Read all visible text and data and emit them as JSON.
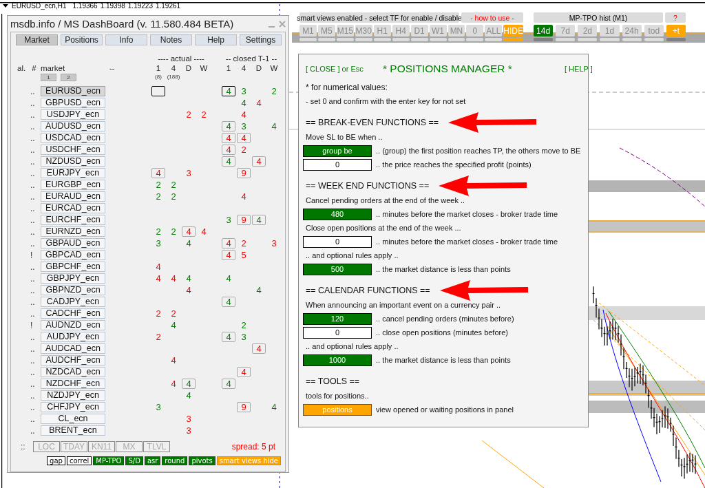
{
  "chart": {
    "symbol": "EURUSD_ecn,H1",
    "prices": [
      "1.19366",
      "1.19398",
      "1.19223",
      "1.19261"
    ]
  },
  "dashboard": {
    "title": "msdb.info / MS DashBoard (v. 11.580.484 BETA)",
    "tabs": [
      {
        "label": "Market",
        "selected": true
      },
      {
        "label": "Positions",
        "selected": false
      },
      {
        "label": "Info",
        "selected": false
      },
      {
        "label": "Notes",
        "selected": false
      },
      {
        "label": "Help",
        "selected": false
      },
      {
        "label": "Settings",
        "selected": false
      }
    ],
    "group_labels": [
      "---- actual ----",
      "-- closed T-1 --"
    ],
    "header": [
      "al.",
      "#",
      "market",
      "--"
    ],
    "actual_columns": [
      "1",
      "4",
      "D",
      "W"
    ],
    "closed_columns": [
      "1",
      "4",
      "D",
      "W"
    ],
    "pages": [
      "1",
      "2"
    ],
    "actual_counts": [
      "(8)",
      "(188)"
    ],
    "rows": [
      {
        "alert": "..",
        "symbol": "EURUSD_ecn",
        "selected": true,
        "cells": {
          "actual_1": {
            "framed": true,
            "highlighted": true
          },
          "closed_1": {
            "value": "4",
            "color": "#008000",
            "framed": true,
            "highlighted": true
          },
          "closed_4": {
            "value": "3",
            "color": "#008000"
          },
          "closed_w": {
            "value": "2",
            "color": "#008000"
          }
        }
      },
      {
        "alert": "..",
        "symbol": "GBPUSD_ecn",
        "selected": false,
        "cells": {
          "closed_4": {
            "value": "4",
            "color": "#008000"
          },
          "closed_d": {
            "value": "4",
            "color": "#ff0000"
          }
        }
      },
      {
        "alert": "..",
        "symbol": "USDJPY_ecn",
        "selected": false,
        "cells": {
          "actual_d": {
            "value": "2",
            "color": "#ff0000"
          },
          "actual_w": {
            "value": "2",
            "color": "#ff0000"
          },
          "closed_4": {
            "value": "4",
            "color": "#ff0000"
          }
        }
      },
      {
        "alert": "..",
        "symbol": "AUDUSD_ecn",
        "selected": false,
        "cells": {
          "closed_1": {
            "value": "4",
            "color": "#008000",
            "framed": true
          },
          "closed_4": {
            "value": "3",
            "color": "#008000"
          },
          "closed_w": {
            "value": "4",
            "color": "#008000"
          }
        }
      },
      {
        "alert": "..",
        "symbol": "USDCAD_ecn",
        "selected": false,
        "cells": {
          "closed_1": {
            "value": "4",
            "color": "#ff0000",
            "framed": true
          },
          "closed_4": {
            "value": "4",
            "color": "#ff0000",
            "framed": true
          }
        }
      },
      {
        "alert": "..",
        "symbol": "USDCHF_ecn",
        "selected": false,
        "cells": {
          "closed_1": {
            "value": "4",
            "color": "#ff0000",
            "framed": true
          },
          "closed_4": {
            "value": "2",
            "color": "#ff0000"
          }
        }
      },
      {
        "alert": "..",
        "symbol": "NZDUSD_ecn",
        "selected": false,
        "cells": {
          "closed_1": {
            "value": "4",
            "color": "#008000",
            "framed": true
          },
          "closed_d": {
            "value": "4",
            "color": "#ff0000",
            "framed": true
          }
        }
      },
      {
        "alert": "..",
        "symbol": "EURJPY_ecn",
        "selected": false,
        "cells": {
          "actual_1": {
            "value": "4",
            "color": "#ff0000",
            "framed": true
          },
          "actual_d": {
            "value": "3",
            "color": "#ff0000"
          },
          "closed_4": {
            "value": "9",
            "color": "#ff0000",
            "framed": true
          }
        }
      },
      {
        "alert": "..",
        "symbol": "EURGBP_ecn",
        "selected": false,
        "cells": {
          "actual_1": {
            "value": "2",
            "color": "#008000"
          },
          "actual_4": {
            "value": "2",
            "color": "#008000"
          }
        }
      },
      {
        "alert": "..",
        "symbol": "EURAUD_ecn",
        "selected": false,
        "cells": {
          "actual_1": {
            "value": "2",
            "color": "#008000"
          },
          "actual_4": {
            "value": "2",
            "color": "#008000"
          },
          "closed_4": {
            "value": "4",
            "color": "#ff0000"
          }
        }
      },
      {
        "alert": "..",
        "symbol": "EURCAD_ecn",
        "selected": false
      },
      {
        "alert": "..",
        "symbol": "EURCHF_ecn",
        "selected": false,
        "cells": {
          "closed_1": {
            "value": "3",
            "color": "#008000"
          },
          "closed_4": {
            "value": "9",
            "color": "#ff0000",
            "framed": true
          },
          "closed_d": {
            "value": "4",
            "color": "#008000",
            "framed": true
          }
        }
      },
      {
        "alert": "..",
        "symbol": "EURNZD_ecn",
        "selected": false,
        "cells": {
          "actual_1": {
            "value": "2",
            "color": "#008000"
          },
          "actual_4": {
            "value": "2",
            "color": "#008000"
          },
          "actual_d": {
            "value": "4",
            "color": "#ff0000",
            "framed": true
          },
          "actual_w": {
            "value": "4",
            "color": "#ff0000"
          }
        }
      },
      {
        "alert": "..",
        "symbol": "GBPAUD_ecn",
        "selected": false,
        "cells": {
          "actual_1": {
            "value": "3",
            "color": "#008000"
          },
          "actual_d": {
            "value": "4",
            "color": "#008000"
          },
          "closed_1": {
            "value": "4",
            "color": "#ff0000",
            "framed": true
          },
          "closed_4": {
            "value": "2",
            "color": "#ff0000"
          },
          "closed_w": {
            "value": "3",
            "color": "#ff0000"
          }
        }
      },
      {
        "alert": "!",
        "symbol": "GBPCAD_ecn",
        "selected": false,
        "cells": {
          "closed_1": {
            "value": "4",
            "color": "#ff0000",
            "framed": true
          },
          "closed_4": {
            "value": "5",
            "color": "#ff0000"
          }
        }
      },
      {
        "alert": "..",
        "symbol": "GBPCHF_ecn",
        "selected": false,
        "cells": {
          "actual_1": {
            "value": "4",
            "color": "#ff0000"
          }
        }
      },
      {
        "alert": "..",
        "symbol": "GBPJPY_ecn",
        "selected": false,
        "cells": {
          "actual_1": {
            "value": "4",
            "color": "#ff0000"
          },
          "actual_4": {
            "value": "4",
            "color": "#ff0000"
          },
          "actual_d": {
            "value": "4",
            "color": "#008000"
          },
          "closed_1": {
            "value": "4",
            "color": "#008000"
          }
        }
      },
      {
        "alert": "..",
        "symbol": "GBPNZD_ecn",
        "selected": false,
        "cells": {
          "actual_d": {
            "value": "4",
            "color": "#ff0000"
          },
          "closed_d": {
            "value": "4",
            "color": "#008000"
          }
        }
      },
      {
        "alert": "..",
        "symbol": "CADJPY_ecn",
        "selected": false,
        "cells": {
          "closed_1": {
            "value": "4",
            "color": "#008000",
            "framed": true
          }
        }
      },
      {
        "alert": "..",
        "symbol": "CADCHF_ecn",
        "selected": false,
        "cells": {
          "actual_1": {
            "value": "2",
            "color": "#ff0000"
          },
          "actual_4": {
            "value": "2",
            "color": "#ff0000"
          }
        }
      },
      {
        "alert": "!",
        "symbol": "AUDNZD_ecn",
        "selected": false,
        "cells": {
          "actual_4": {
            "value": "4",
            "color": "#008000"
          },
          "closed_4": {
            "value": "2",
            "color": "#008000"
          }
        }
      },
      {
        "alert": "..",
        "symbol": "AUDJPY_ecn",
        "selected": false,
        "cells": {
          "actual_1": {
            "value": "2",
            "color": "#ff0000"
          },
          "closed_1": {
            "value": "4",
            "color": "#008000",
            "framed": true
          },
          "closed_4": {
            "value": "3",
            "color": "#008000"
          }
        }
      },
      {
        "alert": "..",
        "symbol": "AUDCAD_ecn",
        "selected": false,
        "cells": {
          "closed_d": {
            "value": "4",
            "color": "#ff0000",
            "framed": true
          }
        }
      },
      {
        "alert": "..",
        "symbol": "AUDCHF_ecn",
        "selected": false,
        "cells": {
          "actual_4": {
            "value": "4",
            "color": "#ff0000"
          }
        }
      },
      {
        "alert": "..",
        "symbol": "NZDCAD_ecn",
        "selected": false,
        "cells": {
          "closed_4": {
            "value": "4",
            "color": "#ff0000",
            "framed": true
          }
        }
      },
      {
        "alert": "..",
        "symbol": "NZDCHF_ecn",
        "selected": false,
        "cells": {
          "actual_4": {
            "value": "4",
            "color": "#ff0000"
          },
          "actual_d": {
            "value": "4",
            "color": "#008000",
            "framed": true
          },
          "closed_1": {
            "value": "4",
            "color": "#008000",
            "framed": true
          }
        }
      },
      {
        "alert": "..",
        "symbol": "NZDJPY_ecn",
        "selected": false,
        "cells": {
          "actual_d": {
            "value": "4",
            "color": "#008000"
          }
        }
      },
      {
        "alert": "..",
        "symbol": "CHFJPY_ecn",
        "selected": false,
        "cells": {
          "actual_1": {
            "value": "3",
            "color": "#008000"
          },
          "closed_4": {
            "value": "9",
            "color": "#ff0000",
            "framed": true
          },
          "closed_w": {
            "value": "4",
            "color": "#008000"
          }
        }
      },
      {
        "alert": "..",
        "symbol": "CL_ecn",
        "selected": false,
        "cells": {
          "actual_d": {
            "value": "3",
            "color": "#ff0000"
          }
        }
      },
      {
        "alert": "..",
        "symbol": "BRENT_ecn",
        "selected": false,
        "cells": {
          "actual_d": {
            "value": "3",
            "color": "#ff0000"
          }
        }
      }
    ],
    "filter_handle": "::",
    "filters": [
      {
        "label": "LOC",
        "disabled": true
      },
      {
        "label": "TDAY",
        "disabled": true
      },
      {
        "label": "KN11",
        "disabled": true
      },
      {
        "label": "MX",
        "disabled": true
      },
      {
        "label": "TLVL",
        "disabled": true
      }
    ],
    "spread": "spread: 5 pt",
    "views": [
      {
        "label": "gap",
        "kind": "toggle",
        "on": false
      },
      {
        "label": "correl",
        "kind": "toggle",
        "on": false
      },
      {
        "label": "MP-TPO",
        "kind": "toggle",
        "on": true
      },
      {
        "label": "S/D",
        "kind": "toggle",
        "on": true
      },
      {
        "label": "asr",
        "kind": "toggle",
        "on": true
      },
      {
        "label": "round",
        "kind": "toggle",
        "on": true
      },
      {
        "label": "pivots",
        "kind": "toggle",
        "on": true
      },
      {
        "label": "smart views hide",
        "kind": "accent"
      }
    ]
  },
  "toolbar": {
    "hint": "smart views enabled - select TF for enable / disable",
    "how_to": "- how to use -",
    "timeframes": [
      {
        "label": "M1",
        "selected": false
      },
      {
        "label": "M5",
        "selected": false
      },
      {
        "label": "M15",
        "selected": false
      },
      {
        "label": "M30",
        "selected": false
      },
      {
        "label": "H1",
        "selected": false
      },
      {
        "label": "H4",
        "selected": false
      },
      {
        "label": "D1",
        "selected": false
      },
      {
        "label": "W1",
        "selected": false
      },
      {
        "label": "MN",
        "selected": false
      },
      {
        "label": "0",
        "selected": false
      },
      {
        "label": "ALL",
        "selected": false
      },
      {
        "label": "HIDE",
        "selected": true
      }
    ],
    "tpo_title": "MP-TPO hist (M1)",
    "tpo_help": "?",
    "tpo_ranges": [
      {
        "label": "14d",
        "selected": true
      },
      {
        "label": "7d",
        "selected": false
      },
      {
        "label": "2d",
        "selected": false
      },
      {
        "label": "1d",
        "selected": false
      },
      {
        "label": "24h",
        "selected": false
      },
      {
        "label": "tod",
        "selected": false
      }
    ],
    "tpo_extra": "+t"
  },
  "positions_manager": {
    "close_link": "[ CLOSE ] or Esc",
    "title": "* POSITIONS MANAGER *",
    "help_link": "[ HELP ]",
    "notes": [
      "* for numerical values:",
      "- set 0 and confirm with the enter key for not set"
    ],
    "sections": [
      {
        "heading": "== BREAK-EVEN FUNCTIONS ==",
        "arrow": true,
        "items": [
          {
            "kind": "text",
            "text": "Move SL to BE when .."
          },
          {
            "kind": "field",
            "value": "group be",
            "on": true,
            "description": ".. (group) the first position reaches TP, the others move to BE"
          },
          {
            "kind": "field",
            "value": "0",
            "on": false,
            "description": ".. the price reaches the specified profit (points)"
          }
        ]
      },
      {
        "heading": "== WEEK END FUNCTIONS ==",
        "arrow": true,
        "items": [
          {
            "kind": "text",
            "text": "Cancel pending orders at the end of the week .."
          },
          {
            "kind": "field",
            "value": "480",
            "on": true,
            "description": ".. minutes before the market closes - broker trade time"
          },
          {
            "kind": "text",
            "text": "Close open positions at the end of the week ..."
          },
          {
            "kind": "field",
            "value": "0",
            "on": false,
            "description": ".. minutes before the market closes - broker trade time"
          },
          {
            "kind": "text",
            "text": ".. and optional rules apply .."
          },
          {
            "kind": "field",
            "value": "500",
            "on": true,
            "description": ".. the market distance is less than points"
          }
        ]
      },
      {
        "heading": "== CALENDAR FUNCTIONS ==",
        "arrow": true,
        "items": [
          {
            "kind": "text",
            "text": "When announcing an important event on a currency pair .."
          },
          {
            "kind": "field",
            "value": "120",
            "on": true,
            "description": ".. cancel pending orders (minutes before)"
          },
          {
            "kind": "field",
            "value": "0",
            "on": false,
            "description": ".. close open positions (minutes before)"
          },
          {
            "kind": "text",
            "text": ".. and optional rules apply .."
          },
          {
            "kind": "field",
            "value": "1000",
            "on": true,
            "description": ".. the market distance is less than points"
          }
        ]
      },
      {
        "heading": "== TOOLS ==",
        "items": [
          {
            "kind": "text",
            "text": "tools for positions.."
          },
          {
            "kind": "button",
            "label": "positions",
            "description": "view opened or waiting positions in panel"
          }
        ]
      }
    ]
  }
}
